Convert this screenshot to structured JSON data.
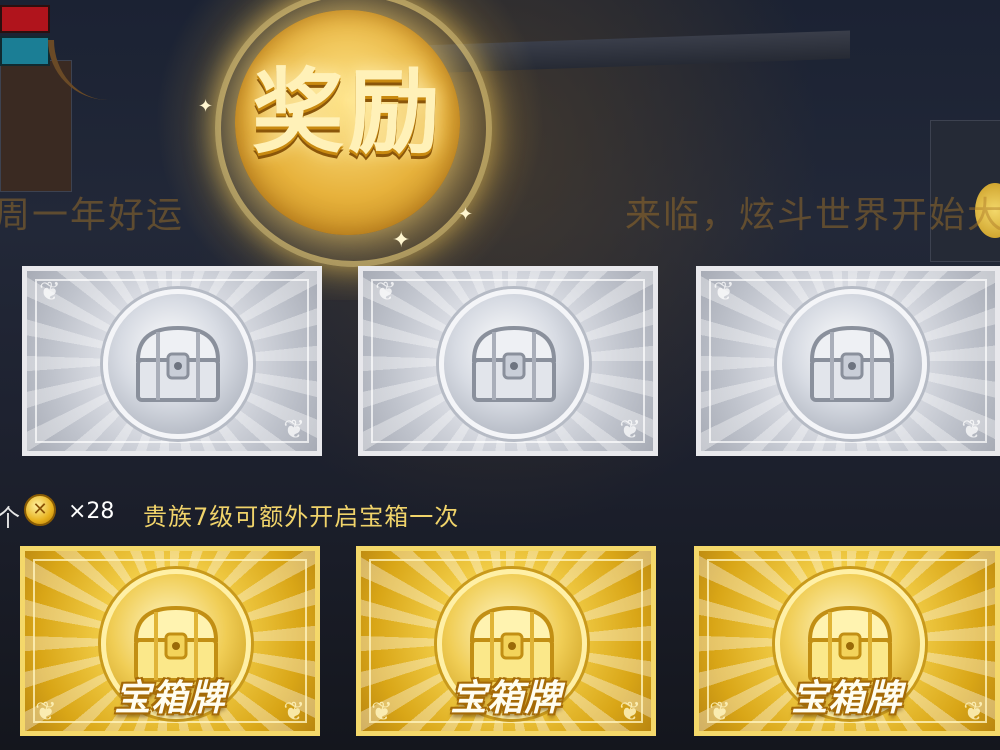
{
  "title": "奖励",
  "ticker": {
    "left_text": "周一年好运",
    "right_text": "来临，炫斗世界开始大"
  },
  "rows": {
    "silver": [
      {
        "id": "silver-1"
      },
      {
        "id": "silver-2"
      },
      {
        "id": "silver-3"
      }
    ],
    "gold": [
      {
        "id": "gold-1",
        "label": "宝箱牌"
      },
      {
        "id": "gold-2",
        "label": "宝箱牌"
      },
      {
        "id": "gold-3",
        "label": "宝箱牌"
      }
    ]
  },
  "info": {
    "unit_char": "个",
    "coin_icon": "gold-coin-icon",
    "coin_glyph": "✕",
    "quantity": "×28",
    "vip_note": "贵族7级可额外开启宝箱一次"
  },
  "colors": {
    "title_gold": "#fff1b8",
    "vip_note": "#f0d36a",
    "silver_card": "#d9dce3",
    "gold_card": "#f3cf4a"
  }
}
